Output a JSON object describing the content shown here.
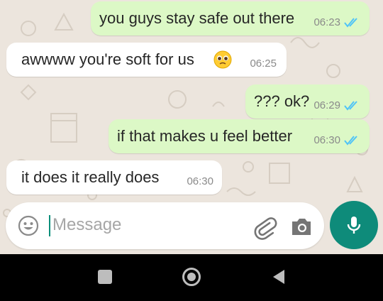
{
  "chat": {
    "messages": [
      {
        "direction": "out",
        "text": "you guys stay safe out there",
        "time": "06:23",
        "status": "read"
      },
      {
        "direction": "in",
        "text": "awwww you're soft for us",
        "emoji": "pleading-face",
        "time": "06:25"
      },
      {
        "direction": "out",
        "text": "??? ok?",
        "time": "06:29",
        "status": "read"
      },
      {
        "direction": "out",
        "text": "if that makes u feel better",
        "time": "06:30",
        "status": "read"
      },
      {
        "direction": "in",
        "text": "it does it really does",
        "time": "06:30"
      }
    ]
  },
  "composer": {
    "placeholder": "Message",
    "icons": {
      "emoji": "smiley-icon",
      "attach": "paperclip-icon",
      "camera": "camera-icon",
      "send": "microphone-icon"
    }
  },
  "colors": {
    "outgoing_bubble": "#dcf8c6",
    "incoming_bubble": "#ffffff",
    "chat_background": "#ece5dd",
    "accent": "#0e8b7a",
    "read_ticks": "#4fc3f7"
  },
  "nav": {
    "icons": [
      "recents-square-icon",
      "home-circle-icon",
      "back-triangle-icon"
    ]
  }
}
